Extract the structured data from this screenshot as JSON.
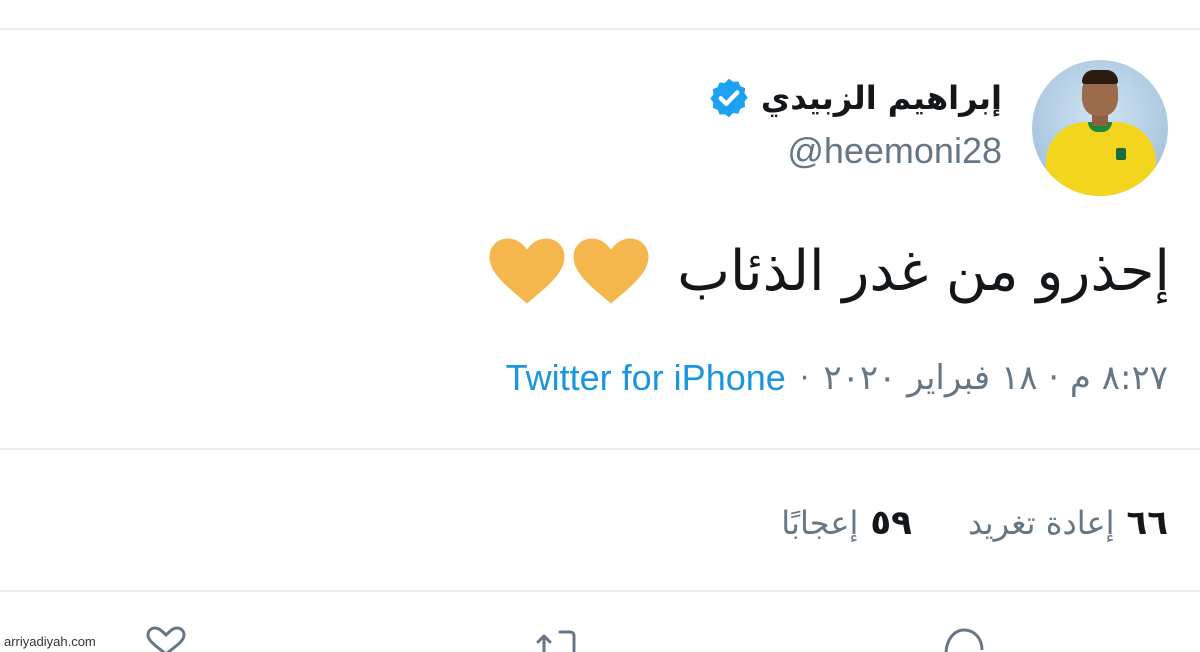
{
  "tweet": {
    "display_name": "إبراهيم الزبيدي",
    "handle": "@heemoni28",
    "text": "إحذرو من غدر الذئاب",
    "emoji_count": 2,
    "timestamp": "٨:٢٧ م · ١٨ فبراير ٢٠٢٠",
    "separator": "·",
    "source": "Twitter for iPhone"
  },
  "stats": {
    "retweets_count": "٦٦",
    "retweets_label": "إعادة تغريد",
    "likes_count": "٥٩",
    "likes_label": "إعجابًا"
  },
  "actions": [
    "reply-icon",
    "retweet-icon",
    "like-icon"
  ],
  "colors": {
    "verified": "#1da1f2",
    "link": "#1b95e0",
    "muted": "#657786",
    "heart": "#f6b64e",
    "divider": "#e6ecf0"
  },
  "watermark": "arriyadiyah.com"
}
